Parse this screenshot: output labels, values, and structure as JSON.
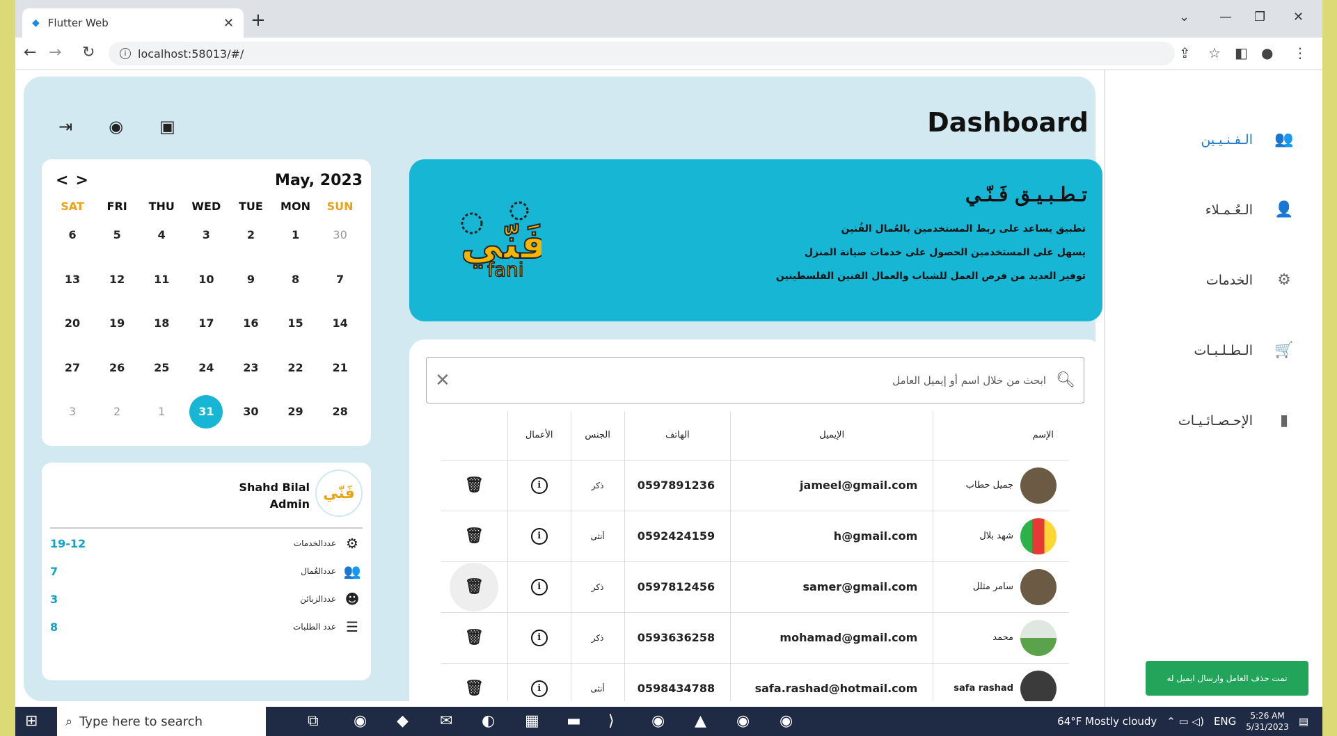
{
  "browser": {
    "tab_title": "Flutter Web",
    "url": "localhost:58013/#/"
  },
  "sidebar": {
    "items": [
      {
        "label": "الـفـنـيـين",
        "icon": "people-icon",
        "active": true
      },
      {
        "label": "الـعُـمـلاء",
        "icon": "person-icon",
        "active": false
      },
      {
        "label": "الخدمات",
        "icon": "gears-icon",
        "active": false
      },
      {
        "label": "الـطـلـبـات",
        "icon": "cart-icon",
        "active": false
      },
      {
        "label": "الإحـصـائـيـات",
        "icon": "bar-chart-icon",
        "active": false
      }
    ]
  },
  "header": {
    "title": "Dashboard"
  },
  "banner": {
    "title": "تـطـبـيـق فَـنّـي",
    "lines": [
      "تطبيق يساعد على ربط المستخدمين بالعُمال الفُنين",
      "يسهل على المستخدمين الحصول على خدمات صيانة المنزل",
      "توفير العديد من فرص العمل للشباب والعمال الفنين الفلسطينين"
    ],
    "logo_ar": "فَنّي",
    "logo_en": "fani"
  },
  "calendar": {
    "title": "May, 2023",
    "prev": "<",
    "next": ">",
    "headers": [
      "SAT",
      "FRI",
      "THU",
      "WED",
      "TUE",
      "MON",
      "SUN"
    ],
    "weeks": [
      [
        "6",
        "5",
        "4",
        "3",
        "2",
        "1",
        "30"
      ],
      [
        "13",
        "12",
        "11",
        "10",
        "9",
        "8",
        "7"
      ],
      [
        "20",
        "19",
        "18",
        "17",
        "16",
        "15",
        "14"
      ],
      [
        "27",
        "26",
        "25",
        "24",
        "23",
        "22",
        "21"
      ],
      [
        "3",
        "2",
        "1",
        "31",
        "30",
        "29",
        "28"
      ]
    ],
    "selected": "31"
  },
  "profile": {
    "name": "Shahd Bilal",
    "role": "Admin",
    "stats": [
      {
        "label": "عددالخدمات",
        "value": "19-12",
        "icon": "gears-icon"
      },
      {
        "label": "عددالعُمال",
        "value": "7",
        "icon": "people-icon"
      },
      {
        "label": "عددالزبائن",
        "value": "3",
        "icon": "emoji-icon"
      },
      {
        "label": "عدد الطلبات",
        "value": "8",
        "icon": "list-icon"
      }
    ]
  },
  "search": {
    "placeholder": "ابحث من خلال اسم أو إيميل العامل"
  },
  "table": {
    "headers": [
      "الأعمال",
      "الجنس",
      "الهاتف",
      "الإيميل",
      "الإسم"
    ],
    "rows": [
      {
        "name": "جميل حطاب",
        "email": "jameel@gmail.com",
        "phone": "0597891236",
        "gender": "ذكر"
      },
      {
        "name": "شهد بلال",
        "email": "h@gmail.com",
        "phone": "0592424159",
        "gender": "أنثى"
      },
      {
        "name": "سامر مثلل",
        "email": "samer@gmail.com",
        "phone": "0597812456",
        "gender": "ذكر"
      },
      {
        "name": "محمد",
        "email": "mohamad@gmail.com",
        "phone": "0593636258",
        "gender": "ذكر"
      },
      {
        "name": "safa rashad",
        "email": "safa.rashad@hotmail.com",
        "phone": "0598434788",
        "gender": "أنثى"
      }
    ]
  },
  "toast": {
    "text": "تمت حذف العامل وارسال ايميل له"
  },
  "taskbar": {
    "search_placeholder": "Type here to search",
    "weather": "64°F  Mostly cloudy",
    "lang": "ENG",
    "time": "5:26 AM",
    "date": "5/31/2023"
  }
}
